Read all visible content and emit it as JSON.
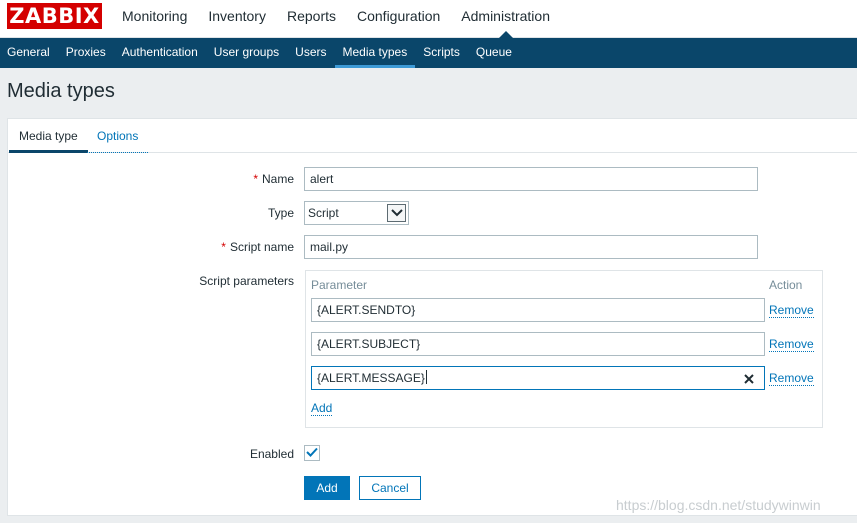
{
  "brand": {
    "logo_text": "ZABBIX",
    "color": "#d40000"
  },
  "topnav": {
    "items": [
      {
        "label": "Monitoring"
      },
      {
        "label": "Inventory"
      },
      {
        "label": "Reports"
      },
      {
        "label": "Configuration"
      },
      {
        "label": "Administration",
        "active": true
      }
    ]
  },
  "subnav": {
    "items": [
      {
        "label": "General"
      },
      {
        "label": "Proxies"
      },
      {
        "label": "Authentication"
      },
      {
        "label": "User groups"
      },
      {
        "label": "Users"
      },
      {
        "label": "Media types",
        "active": true
      },
      {
        "label": "Scripts"
      },
      {
        "label": "Queue"
      }
    ],
    "bg_color": "#0a466a"
  },
  "page": {
    "title": "Media types"
  },
  "tabs": {
    "media_type": "Media type",
    "options": "Options",
    "active": "Media type"
  },
  "form": {
    "required_marker": "*",
    "name": {
      "label": "Name",
      "value": "alert"
    },
    "type": {
      "label": "Type",
      "selected": "Script"
    },
    "script_name": {
      "label": "Script name",
      "value": "mail.py"
    },
    "script_parameters": {
      "label": "Script parameters",
      "col_parameter": "Parameter",
      "col_action": "Action",
      "rows": [
        {
          "value": "{ALERT.SENDTO}",
          "action": "Remove"
        },
        {
          "value": "{ALERT.SUBJECT}",
          "action": "Remove"
        },
        {
          "value": "{ALERT.MESSAGE}",
          "action": "Remove",
          "focused": true
        }
      ],
      "add_label": "Add"
    },
    "enabled": {
      "label": "Enabled",
      "checked": true
    },
    "buttons": {
      "add": "Add",
      "cancel": "Cancel"
    }
  },
  "icons": {
    "clear": "close-icon",
    "check": "checkmark-icon",
    "select_arrow": "chevron-down-icon"
  },
  "watermark": "https://blog.csdn.net/studywinwin",
  "colors": {
    "accent": "#0275b8",
    "required": "#d40000",
    "active_tab_underline": "#3d9ad6"
  }
}
